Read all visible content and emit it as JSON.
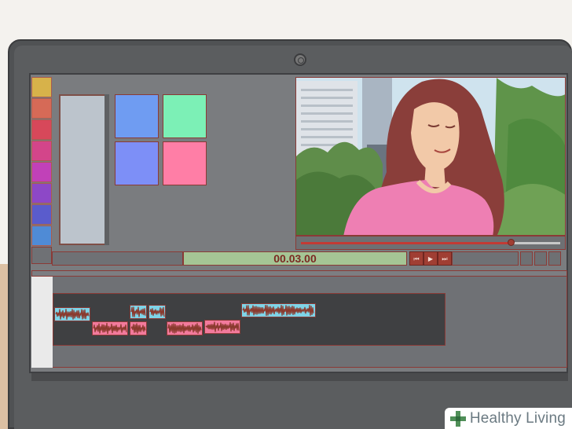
{
  "window": {
    "title": ""
  },
  "swatches": [
    "#d7b24a",
    "#d66a57",
    "#d7485a",
    "#d3458a",
    "#c141b8",
    "#8d48c7",
    "#5a5ccc",
    "#4f8bd6"
  ],
  "media_tiles": [
    "#6f9cf2",
    "#7cf0b6",
    "#7d8ff7",
    "#ff7ea6"
  ],
  "player": {
    "timecode": "00.03.00",
    "progress": 0.81,
    "controls": [
      "skip-back-icon",
      "play-icon",
      "skip-forward-icon"
    ],
    "control_glyphs": [
      "⏮",
      "▶",
      "⏭"
    ]
  },
  "brand": {
    "text": "Healthy Living",
    "icon": "plus-icon"
  },
  "colors": {
    "accent": "#a03e33",
    "clip_blue": "#7ed4e8",
    "clip_pink": "#f27a9c",
    "timecode_bg": "#a5c595"
  }
}
